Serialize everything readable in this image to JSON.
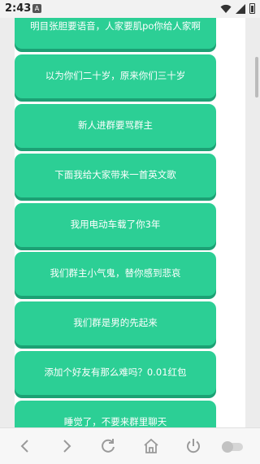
{
  "status": {
    "time": "2:43",
    "notification_badge": "A"
  },
  "items": [
    "明目张胆要语音，人家要肌po你给人家啊",
    "以为你们二十岁，原来你们三十岁",
    "新人进群要骂群主",
    "下面我给大家带来一首英文歌",
    "我用电动车载了你3年",
    "我们群主小气鬼，替你感到悲哀",
    "我们群是男的先起来",
    "添加个好友有那么难吗？0.01红包",
    "睡觉了，不要来群里聊天"
  ],
  "colors": {
    "item_bg": "#2ccf95",
    "item_shadow": "#1ca174",
    "text": "#ffffff"
  },
  "toolbar_icons": [
    "back-icon",
    "forward-icon",
    "refresh-icon",
    "home-icon",
    "power-icon",
    "toggle-icon"
  ]
}
